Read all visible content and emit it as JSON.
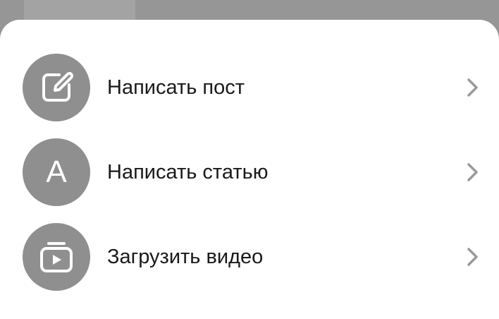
{
  "menu": {
    "items": [
      {
        "label": "Написать пост",
        "icon": "edit-icon"
      },
      {
        "label": "Написать статью",
        "icon": "article-icon",
        "icon_letter": "A"
      },
      {
        "label": "Загрузить видео",
        "icon": "video-upload-icon"
      }
    ]
  },
  "colors": {
    "backdrop": "#969696",
    "sheet": "#ffffff",
    "icon_circle": "#8f8f8f",
    "icon_glyph": "#ffffff",
    "label_text": "#1a1a1a",
    "chevron": "#9a9a9a"
  }
}
